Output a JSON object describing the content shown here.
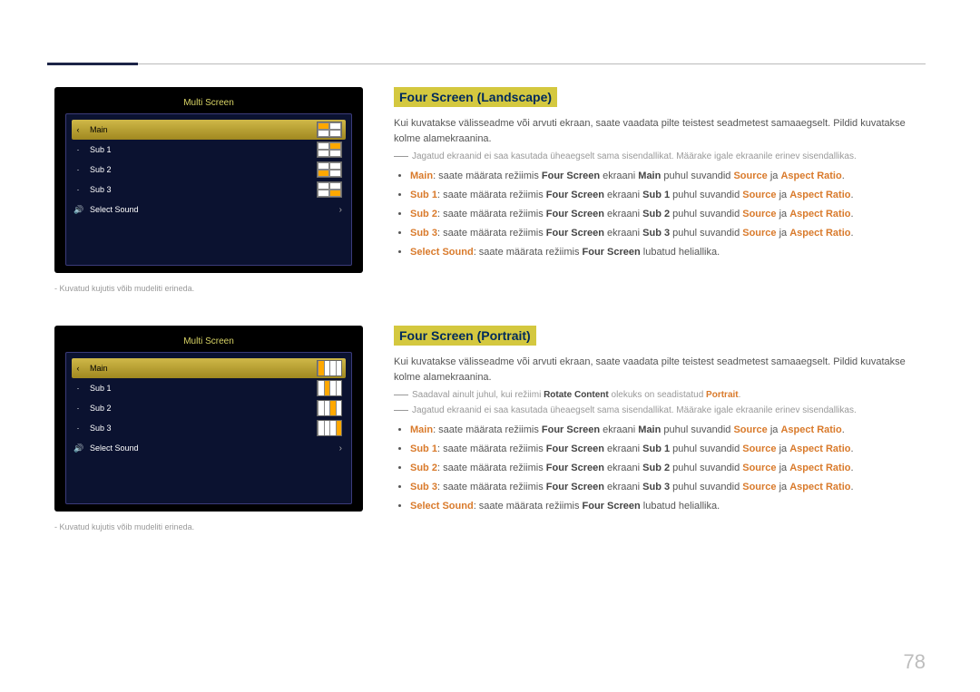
{
  "pageNumber": "78",
  "caption": "-  Kuvatud kujutis võib mudeliti erineda.",
  "osd": {
    "title": "Multi Screen",
    "rows": [
      "Main",
      "Sub 1",
      "Sub 2",
      "Sub 3",
      "Select Sound"
    ],
    "side": "Return"
  },
  "landscape": {
    "heading": "Four Screen (Landscape)",
    "intro": "Kui kuvatakse välisseadme või arvuti ekraan, saate vaadata pilte teistest seadmetest samaaegselt. Pildid kuvatakse kolme alamekraanina.",
    "note1": "Jagatud ekraanid ei saa kasutada üheaegselt sama sisendallikat. Määrake igale ekraanile erinev sisendallikas.",
    "bullets": [
      {
        "lead": "Main",
        "pre": ": saate määrata režiimis ",
        "m1": "Four Screen",
        "mid": " ekraani ",
        "m2": "Main",
        "mid2": " puhul suvandid ",
        "m3": "Source",
        "ja": " ja ",
        "m4": "Aspect Ratio",
        "end": "."
      },
      {
        "lead": "Sub 1",
        "pre": ": saate määrata režiimis ",
        "m1": "Four Screen",
        "mid": " ekraani ",
        "m2": "Sub 1",
        "mid2": " puhul suvandid ",
        "m3": "Source",
        "ja": " ja ",
        "m4": "Aspect Ratio",
        "end": "."
      },
      {
        "lead": "Sub 2",
        "pre": ": saate määrata režiimis ",
        "m1": "Four Screen",
        "mid": " ekraani ",
        "m2": "Sub 2",
        "mid2": " puhul suvandid ",
        "m3": "Source",
        "ja": " ja ",
        "m4": "Aspect Ratio",
        "end": "."
      },
      {
        "lead": "Sub 3",
        "pre": ": saate määrata režiimis ",
        "m1": "Four Screen",
        "mid": " ekraani ",
        "m2": "Sub 3",
        "mid2": " puhul suvandid ",
        "m3": "Source",
        "ja": " ja ",
        "m4": "Aspect Ratio",
        "end": "."
      },
      {
        "lead": "Select Sound",
        "pre": ": saate määrata režiimis ",
        "m1": "Four Screen",
        "mid": " lubatud heliallika.",
        "m2": "",
        "mid2": "",
        "m3": "",
        "ja": "",
        "m4": "",
        "end": ""
      }
    ]
  },
  "portrait": {
    "heading": "Four Screen (Portrait)",
    "intro": "Kui kuvatakse välisseadme või arvuti ekraan, saate vaadata pilte teistest seadmetest samaaegselt. Pildid kuvatakse kolme alamekraanina.",
    "note0a": "Saadaval ainult juhul, kui režiimi ",
    "note0b": "Rotate Content",
    "note0c": " olekuks on seadistatud ",
    "note0d": "Portrait",
    "note0e": ".",
    "note1": "Jagatud ekraanid ei saa kasutada üheaegselt sama sisendallikat. Määrake igale ekraanile erinev sisendallikas.",
    "bullets": [
      {
        "lead": "Main",
        "pre": ": saate määrata režiimis ",
        "m1": "Four Screen",
        "mid": " ekraani ",
        "m2": "Main",
        "mid2": " puhul suvandid ",
        "m3": "Source",
        "ja": " ja ",
        "m4": "Aspect Ratio",
        "end": "."
      },
      {
        "lead": "Sub 1",
        "pre": ": saate määrata režiimis ",
        "m1": "Four Screen",
        "mid": " ekraani ",
        "m2": "Sub 1",
        "mid2": " puhul suvandid ",
        "m3": "Source",
        "ja": " ja ",
        "m4": "Aspect Ratio",
        "end": "."
      },
      {
        "lead": "Sub 2",
        "pre": ": saate määrata režiimis ",
        "m1": "Four Screen",
        "mid": " ekraani ",
        "m2": "Sub 2",
        "mid2": " puhul suvandid ",
        "m3": "Source",
        "ja": " ja ",
        "m4": "Aspect Ratio",
        "end": "."
      },
      {
        "lead": "Sub 3",
        "pre": ": saate määrata režiimis ",
        "m1": "Four Screen",
        "mid": " ekraani ",
        "m2": "Sub 3",
        "mid2": " puhul suvandid ",
        "m3": "Source",
        "ja": " ja ",
        "m4": "Aspect Ratio",
        "end": "."
      },
      {
        "lead": "Select Sound",
        "pre": ": saate määrata režiimis ",
        "m1": "Four Screen",
        "mid": " lubatud heliallika.",
        "m2": "",
        "mid2": "",
        "m3": "",
        "ja": "",
        "m4": "",
        "end": ""
      }
    ]
  }
}
